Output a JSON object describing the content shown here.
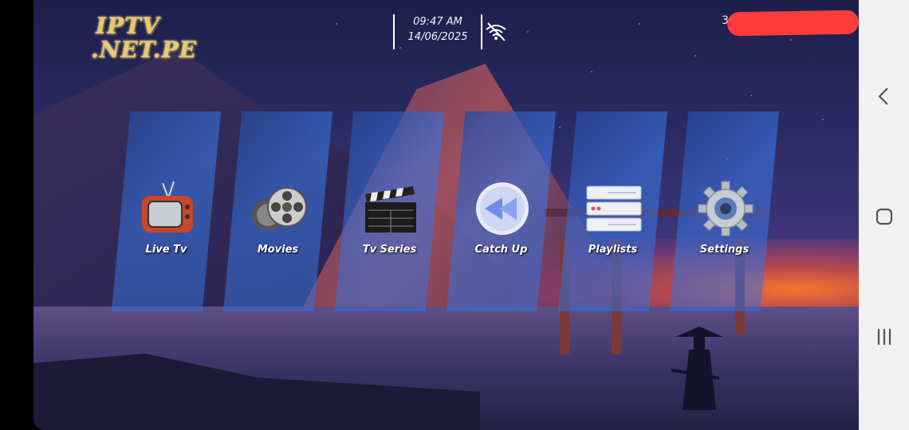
{
  "app": {
    "logo_line1": "IPTV",
    "logo_line2": ".NET.PE"
  },
  "status": {
    "time": "09:47 AM",
    "date": "14/06/2025",
    "account_prefix": "30",
    "wifi_icon": "wifi-off-icon"
  },
  "menu": [
    {
      "label": "Live Tv",
      "icon": "tv-icon"
    },
    {
      "label": "Movies",
      "icon": "film-reels-icon"
    },
    {
      "label": "Tv Series",
      "icon": "clapperboard-icon"
    },
    {
      "label": "Catch Up",
      "icon": "rewind-icon"
    },
    {
      "label": "Playlists",
      "icon": "server-stack-icon"
    },
    {
      "label": "Settings",
      "icon": "gear-icon"
    }
  ],
  "colors": {
    "tile": "#3c78e6",
    "logo_gold": "#e8c877",
    "redaction": "#ff3b3b",
    "navbar": "#f1f1f1"
  },
  "system_nav": {
    "back": "back-icon",
    "home": "home-icon",
    "recents": "recents-icon"
  }
}
